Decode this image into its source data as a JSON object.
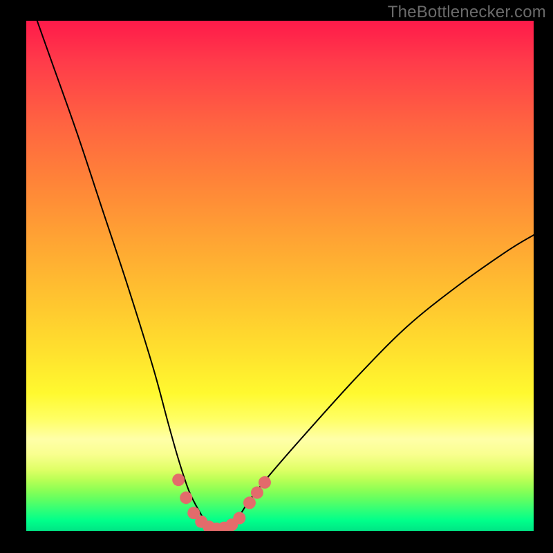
{
  "watermark": "TheBottlenecker.com",
  "chart_data": {
    "type": "line",
    "title": "",
    "xlabel": "",
    "ylabel": "",
    "xlim": [
      0,
      100
    ],
    "ylim": [
      0,
      100
    ],
    "series": [
      {
        "name": "bottleneck-curve",
        "x": [
          0,
          5,
          10,
          15,
          20,
          25,
          28,
          30,
          32,
          34,
          36,
          38,
          40,
          42,
          44,
          48,
          55,
          65,
          75,
          85,
          95,
          100
        ],
        "y": [
          106,
          92,
          78,
          63,
          48,
          32,
          21,
          14,
          8,
          4,
          1,
          0,
          1,
          3,
          6,
          11,
          19,
          30,
          40,
          48,
          55,
          58
        ]
      }
    ],
    "markers": {
      "name": "highlight-dots",
      "color": "#e36b6b",
      "points": [
        {
          "x": 30.0,
          "y": 10.0
        },
        {
          "x": 31.5,
          "y": 6.5
        },
        {
          "x": 33.0,
          "y": 3.5
        },
        {
          "x": 34.5,
          "y": 1.8
        },
        {
          "x": 36.0,
          "y": 0.8
        },
        {
          "x": 37.5,
          "y": 0.4
        },
        {
          "x": 39.0,
          "y": 0.6
        },
        {
          "x": 40.5,
          "y": 1.2
        },
        {
          "x": 42.0,
          "y": 2.5
        },
        {
          "x": 44.0,
          "y": 5.5
        },
        {
          "x": 45.5,
          "y": 7.5
        },
        {
          "x": 47.0,
          "y": 9.5
        }
      ]
    }
  }
}
